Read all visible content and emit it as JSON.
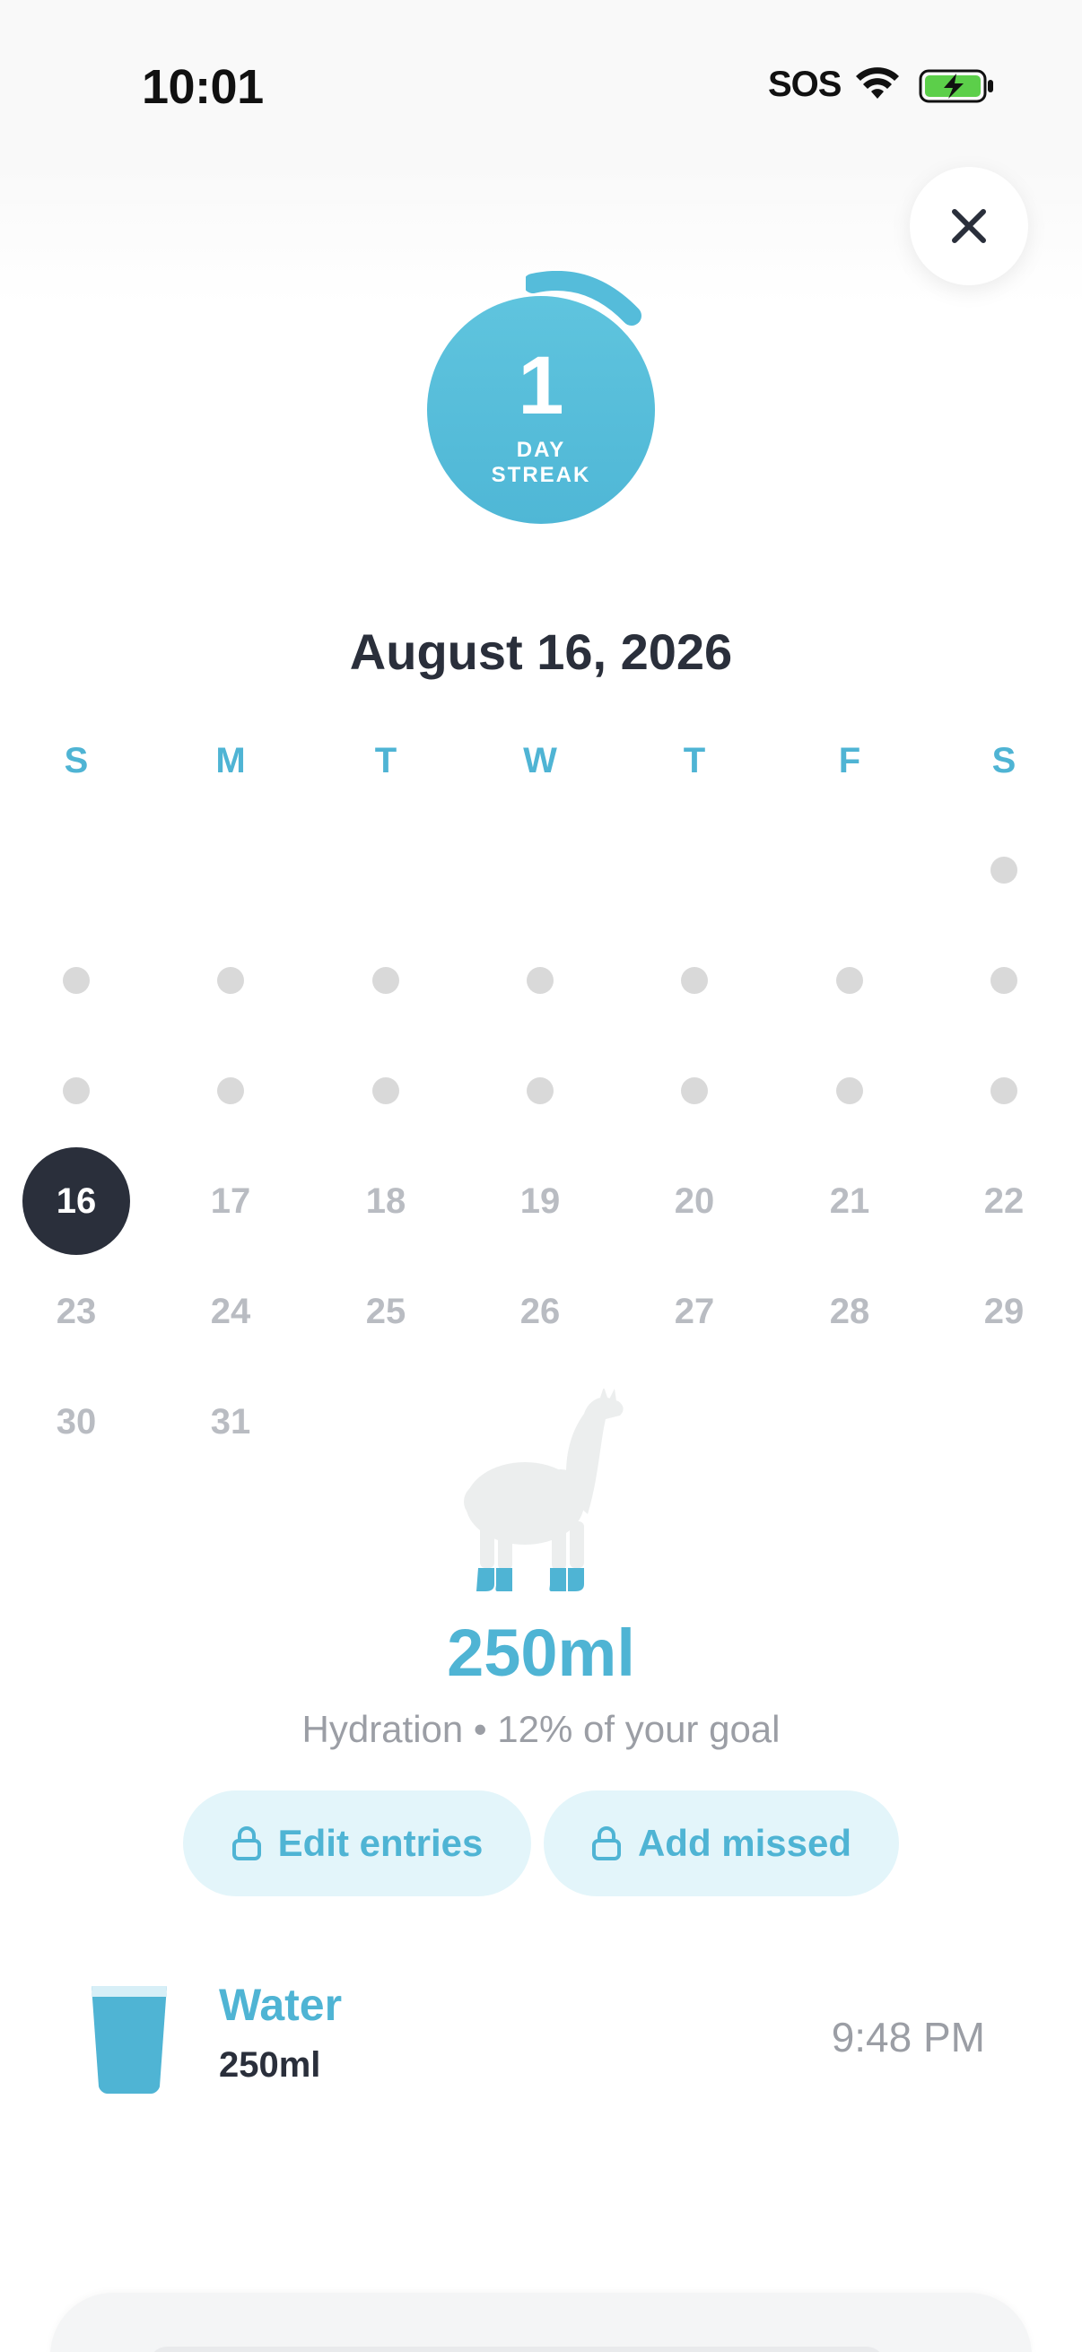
{
  "status_bar": {
    "time": "10:01",
    "carrier": "SOS"
  },
  "streak": {
    "number": "1",
    "label_line1": "DAY",
    "label_line2": "STREAK",
    "color": "#55bcda"
  },
  "calendar": {
    "title": "August 16, 2026",
    "weekdays": [
      "S",
      "M",
      "T",
      "W",
      "T",
      "F",
      "S"
    ],
    "selected_day": "16",
    "row4": [
      "16",
      "17",
      "18",
      "19",
      "20",
      "21",
      "22"
    ],
    "row5": [
      "23",
      "24",
      "25",
      "26",
      "27",
      "28",
      "29"
    ],
    "row6": [
      "30",
      "31"
    ]
  },
  "hydration": {
    "total": "250ml",
    "summary": "Hydration • 12% of your goal",
    "progress_percent": 12
  },
  "actions": {
    "edit_label": "Edit entries",
    "add_label": "Add missed"
  },
  "entry": {
    "name": "Water",
    "amount": "250ml",
    "time": "9:48 PM"
  },
  "colors": {
    "accent": "#4fb4d4",
    "dark": "#2a2f3b",
    "muted": "#9b9ea5",
    "pill_bg": "#e3f5fa"
  }
}
